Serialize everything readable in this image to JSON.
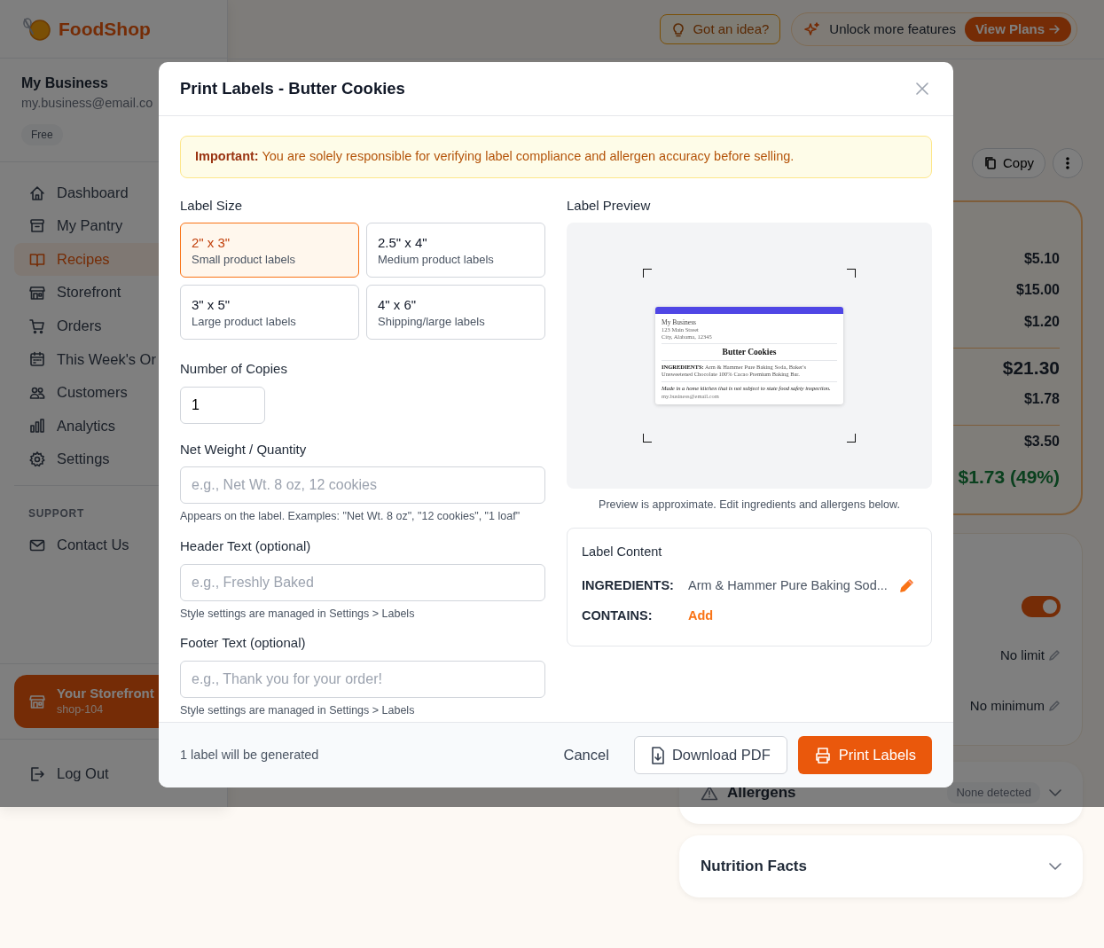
{
  "app": {
    "brand": "FoodShop"
  },
  "topbar": {
    "idea_button": "Got an idea?",
    "promo_text": "Unlock more features",
    "promo_button": "View Plans"
  },
  "sidebar": {
    "business_name": "My Business",
    "email": "my.business@email.co",
    "plan_badge": "Free",
    "items": [
      {
        "label": "Dashboard",
        "selected": false
      },
      {
        "label": "My Pantry",
        "selected": false
      },
      {
        "label": "Recipes",
        "selected": true
      },
      {
        "label": "Storefront",
        "selected": false
      },
      {
        "label": "Orders",
        "selected": false
      },
      {
        "label": "This Week's Or",
        "selected": false
      },
      {
        "label": "Customers",
        "selected": false
      },
      {
        "label": "Analytics",
        "selected": false
      },
      {
        "label": "Settings",
        "selected": false
      }
    ],
    "support_heading": "SUPPORT",
    "support_items": [
      {
        "label": "Contact Us"
      }
    ],
    "storefront": {
      "title": "Your Storefront",
      "slug": "shop-104"
    },
    "logout": "Log Out"
  },
  "recipe": {
    "actions": [
      {
        "label": "Copy",
        "kind": "copy"
      },
      {
        "kind": "more"
      }
    ],
    "costs": [
      {
        "value": "$5.10",
        "kind": "line"
      },
      {
        "value": "$15.00",
        "kind": "line"
      },
      {
        "value": "$1.20",
        "kind": "line"
      },
      {
        "value": "$21.30",
        "kind": "total"
      },
      {
        "value": "$1.78",
        "kind": "line"
      },
      {
        "value": "$3.50",
        "kind": "line"
      },
      {
        "value": "$1.73 (49%)",
        "kind": "profit"
      }
    ],
    "settings": {
      "toggle_on": true,
      "limit": "No limit",
      "minimum": "No minimum"
    },
    "allergens": {
      "title": "Allergens",
      "badge": "None detected"
    },
    "nutrition": {
      "title": "Nutrition Facts"
    }
  },
  "modal": {
    "title": "Print Labels - Butter Cookies",
    "notice": "**Important:** You are solely responsible for verifying label compliance and allergen accuracy before selling.",
    "label_size_heading": "Label Size",
    "label_sizes": [
      {
        "size": "2\" x 3\"",
        "description": "Small product labels",
        "selected": true
      },
      {
        "size": "2.5\" x 4\"",
        "description": "Medium product labels",
        "selected": false
      },
      {
        "size": "3\" x 5\"",
        "description": "Large product labels",
        "selected": false
      },
      {
        "size": "4\" x 6\"",
        "description": "Shipping/large labels",
        "selected": false
      }
    ],
    "copies": {
      "label": "Number of Copies",
      "value": "1"
    },
    "fields": [
      {
        "label": "Net Weight / Quantity",
        "placeholder": "e.g., Net Wt. 8 oz, 12 cookies",
        "help": "Appears on the label. Examples: \"Net Wt. 8 oz\", \"12 cookies\", \"1 loaf\""
      },
      {
        "label": "Header Text (optional)",
        "placeholder": "e.g., Freshly Baked",
        "help": "Style settings are managed in Settings > Labels"
      },
      {
        "label": "Footer Text (optional)",
        "placeholder": "e.g., Thank you for your order!",
        "help": "Style settings are managed in Settings > Labels"
      }
    ],
    "preview": {
      "heading": "Label Preview",
      "business": "My Business",
      "street": "123 Main Street",
      "city": "City, Alabama, 12345",
      "product": "Butter Cookies",
      "ingredients": "**INGREDIENTS:** Arm & Hammer Pure Baking Soda, Baker's Unsweetened Chocolate 100% Cacao Premium Baking Bar.",
      "disclaimer": "Made in a home kitchen that is not subject to state food safety inspection.",
      "email": "my.business@email.com",
      "caption": "Preview is approximate. Edit ingredients and allergens below."
    },
    "content": {
      "heading": "Label Content",
      "rows": [
        {
          "key": "INGREDIENTS:",
          "value": "Arm & Hammer Pure Baking Sod...",
          "kind": "edit"
        },
        {
          "key": "CONTAINS:",
          "value": "Add",
          "kind": "add"
        }
      ]
    },
    "footer": {
      "summary": "1 label will be generated",
      "cancel": "Cancel",
      "download": "Download PDF",
      "print": "Print Labels"
    }
  }
}
